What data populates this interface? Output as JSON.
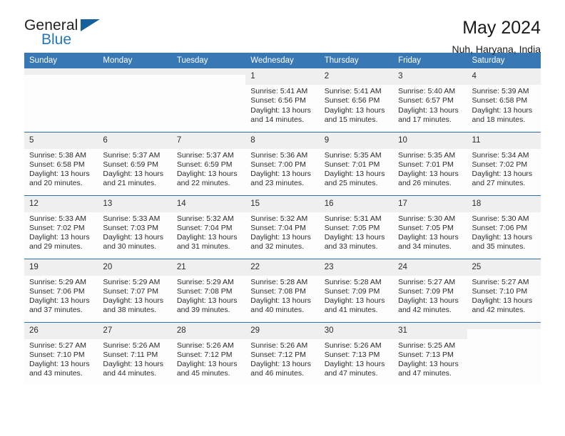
{
  "brand": {
    "word_one": "General",
    "word_two": "Blue",
    "flag_icon": "triangle-flag-icon"
  },
  "header": {
    "title": "May 2024",
    "location": "Nuh, Haryana, India"
  },
  "colors": {
    "header_blue": "#3878b4",
    "row_divider_blue": "#2a6fae",
    "daynum_gray": "#efefef",
    "brand_blue": "#2476bc",
    "flag_blue": "#15619e"
  },
  "labels": {
    "sunrise_prefix": "Sunrise:",
    "sunset_prefix": "Sunset:",
    "daylight_prefix": "Daylight:"
  },
  "weekday_headers": [
    "Sunday",
    "Monday",
    "Tuesday",
    "Wednesday",
    "Thursday",
    "Friday",
    "Saturday"
  ],
  "weeks": [
    [
      {
        "day": "",
        "empty": true,
        "sunrise": "",
        "sunset": "",
        "daylight": ""
      },
      {
        "day": "",
        "empty": true,
        "sunrise": "",
        "sunset": "",
        "daylight": ""
      },
      {
        "day": "",
        "empty": true,
        "sunrise": "",
        "sunset": "",
        "daylight": ""
      },
      {
        "day": "1",
        "empty": false,
        "sunrise": "Sunrise: 5:41 AM",
        "sunset": "Sunset: 6:56 PM",
        "daylight": "Daylight: 13 hours and 14 minutes."
      },
      {
        "day": "2",
        "empty": false,
        "sunrise": "Sunrise: 5:41 AM",
        "sunset": "Sunset: 6:56 PM",
        "daylight": "Daylight: 13 hours and 15 minutes."
      },
      {
        "day": "3",
        "empty": false,
        "sunrise": "Sunrise: 5:40 AM",
        "sunset": "Sunset: 6:57 PM",
        "daylight": "Daylight: 13 hours and 17 minutes."
      },
      {
        "day": "4",
        "empty": false,
        "sunrise": "Sunrise: 5:39 AM",
        "sunset": "Sunset: 6:58 PM",
        "daylight": "Daylight: 13 hours and 18 minutes."
      }
    ],
    [
      {
        "day": "5",
        "empty": false,
        "sunrise": "Sunrise: 5:38 AM",
        "sunset": "Sunset: 6:58 PM",
        "daylight": "Daylight: 13 hours and 20 minutes."
      },
      {
        "day": "6",
        "empty": false,
        "sunrise": "Sunrise: 5:37 AM",
        "sunset": "Sunset: 6:59 PM",
        "daylight": "Daylight: 13 hours and 21 minutes."
      },
      {
        "day": "7",
        "empty": false,
        "sunrise": "Sunrise: 5:37 AM",
        "sunset": "Sunset: 6:59 PM",
        "daylight": "Daylight: 13 hours and 22 minutes."
      },
      {
        "day": "8",
        "empty": false,
        "sunrise": "Sunrise: 5:36 AM",
        "sunset": "Sunset: 7:00 PM",
        "daylight": "Daylight: 13 hours and 23 minutes."
      },
      {
        "day": "9",
        "empty": false,
        "sunrise": "Sunrise: 5:35 AM",
        "sunset": "Sunset: 7:01 PM",
        "daylight": "Daylight: 13 hours and 25 minutes."
      },
      {
        "day": "10",
        "empty": false,
        "sunrise": "Sunrise: 5:35 AM",
        "sunset": "Sunset: 7:01 PM",
        "daylight": "Daylight: 13 hours and 26 minutes."
      },
      {
        "day": "11",
        "empty": false,
        "sunrise": "Sunrise: 5:34 AM",
        "sunset": "Sunset: 7:02 PM",
        "daylight": "Daylight: 13 hours and 27 minutes."
      }
    ],
    [
      {
        "day": "12",
        "empty": false,
        "sunrise": "Sunrise: 5:33 AM",
        "sunset": "Sunset: 7:02 PM",
        "daylight": "Daylight: 13 hours and 29 minutes."
      },
      {
        "day": "13",
        "empty": false,
        "sunrise": "Sunrise: 5:33 AM",
        "sunset": "Sunset: 7:03 PM",
        "daylight": "Daylight: 13 hours and 30 minutes."
      },
      {
        "day": "14",
        "empty": false,
        "sunrise": "Sunrise: 5:32 AM",
        "sunset": "Sunset: 7:04 PM",
        "daylight": "Daylight: 13 hours and 31 minutes."
      },
      {
        "day": "15",
        "empty": false,
        "sunrise": "Sunrise: 5:32 AM",
        "sunset": "Sunset: 7:04 PM",
        "daylight": "Daylight: 13 hours and 32 minutes."
      },
      {
        "day": "16",
        "empty": false,
        "sunrise": "Sunrise: 5:31 AM",
        "sunset": "Sunset: 7:05 PM",
        "daylight": "Daylight: 13 hours and 33 minutes."
      },
      {
        "day": "17",
        "empty": false,
        "sunrise": "Sunrise: 5:30 AM",
        "sunset": "Sunset: 7:05 PM",
        "daylight": "Daylight: 13 hours and 34 minutes."
      },
      {
        "day": "18",
        "empty": false,
        "sunrise": "Sunrise: 5:30 AM",
        "sunset": "Sunset: 7:06 PM",
        "daylight": "Daylight: 13 hours and 35 minutes."
      }
    ],
    [
      {
        "day": "19",
        "empty": false,
        "sunrise": "Sunrise: 5:29 AM",
        "sunset": "Sunset: 7:06 PM",
        "daylight": "Daylight: 13 hours and 37 minutes."
      },
      {
        "day": "20",
        "empty": false,
        "sunrise": "Sunrise: 5:29 AM",
        "sunset": "Sunset: 7:07 PM",
        "daylight": "Daylight: 13 hours and 38 minutes."
      },
      {
        "day": "21",
        "empty": false,
        "sunrise": "Sunrise: 5:29 AM",
        "sunset": "Sunset: 7:08 PM",
        "daylight": "Daylight: 13 hours and 39 minutes."
      },
      {
        "day": "22",
        "empty": false,
        "sunrise": "Sunrise: 5:28 AM",
        "sunset": "Sunset: 7:08 PM",
        "daylight": "Daylight: 13 hours and 40 minutes."
      },
      {
        "day": "23",
        "empty": false,
        "sunrise": "Sunrise: 5:28 AM",
        "sunset": "Sunset: 7:09 PM",
        "daylight": "Daylight: 13 hours and 41 minutes."
      },
      {
        "day": "24",
        "empty": false,
        "sunrise": "Sunrise: 5:27 AM",
        "sunset": "Sunset: 7:09 PM",
        "daylight": "Daylight: 13 hours and 42 minutes."
      },
      {
        "day": "25",
        "empty": false,
        "sunrise": "Sunrise: 5:27 AM",
        "sunset": "Sunset: 7:10 PM",
        "daylight": "Daylight: 13 hours and 42 minutes."
      }
    ],
    [
      {
        "day": "26",
        "empty": false,
        "sunrise": "Sunrise: 5:27 AM",
        "sunset": "Sunset: 7:10 PM",
        "daylight": "Daylight: 13 hours and 43 minutes."
      },
      {
        "day": "27",
        "empty": false,
        "sunrise": "Sunrise: 5:26 AM",
        "sunset": "Sunset: 7:11 PM",
        "daylight": "Daylight: 13 hours and 44 minutes."
      },
      {
        "day": "28",
        "empty": false,
        "sunrise": "Sunrise: 5:26 AM",
        "sunset": "Sunset: 7:12 PM",
        "daylight": "Daylight: 13 hours and 45 minutes."
      },
      {
        "day": "29",
        "empty": false,
        "sunrise": "Sunrise: 5:26 AM",
        "sunset": "Sunset: 7:12 PM",
        "daylight": "Daylight: 13 hours and 46 minutes."
      },
      {
        "day": "30",
        "empty": false,
        "sunrise": "Sunrise: 5:26 AM",
        "sunset": "Sunset: 7:13 PM",
        "daylight": "Daylight: 13 hours and 47 minutes."
      },
      {
        "day": "31",
        "empty": false,
        "sunrise": "Sunrise: 5:25 AM",
        "sunset": "Sunset: 7:13 PM",
        "daylight": "Daylight: 13 hours and 47 minutes."
      },
      {
        "day": "",
        "empty": true,
        "sunrise": "",
        "sunset": "",
        "daylight": ""
      }
    ]
  ]
}
